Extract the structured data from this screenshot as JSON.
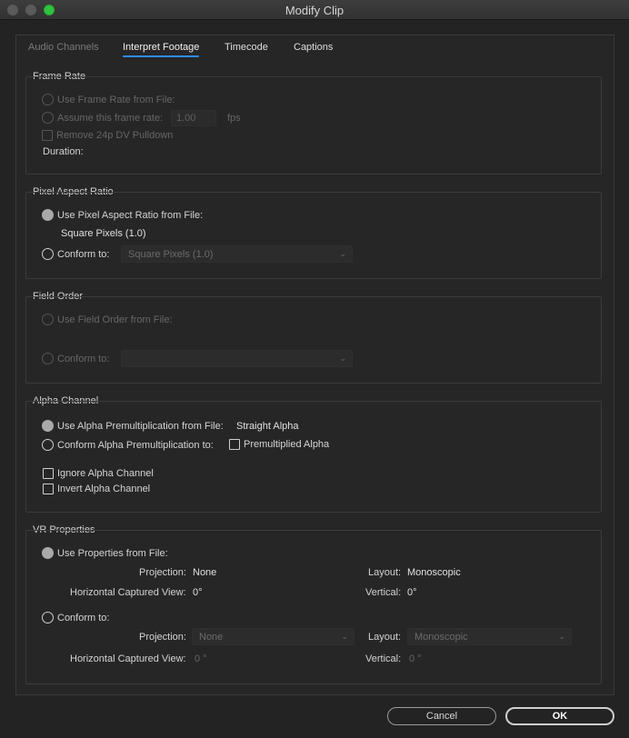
{
  "window": {
    "title": "Modify Clip"
  },
  "tabs": [
    {
      "label": "Audio Channels"
    },
    {
      "label": "Interpret Footage"
    },
    {
      "label": "Timecode"
    },
    {
      "label": "Captions"
    }
  ],
  "frame_rate": {
    "title": "Frame Rate",
    "use_from_file": "Use Frame Rate from File:",
    "assume": "Assume this frame rate:",
    "rate_value": "1.00",
    "unit": "fps",
    "remove_pulldown": "Remove 24p DV Pulldown",
    "duration": "Duration:"
  },
  "pixel_aspect": {
    "title": "Pixel Aspect Ratio",
    "use_from_file": "Use Pixel Aspect Ratio from File:",
    "file_value": "Square Pixels (1.0)",
    "conform": "Conform to:",
    "conform_value": "Square Pixels (1.0)"
  },
  "field_order": {
    "title": "Field Order",
    "use_from_file": "Use Field Order from File:",
    "conform": "Conform to:",
    "conform_value": ""
  },
  "alpha": {
    "title": "Alpha Channel",
    "use_from_file": "Use Alpha Premultiplication from File:",
    "file_value": "Straight Alpha",
    "conform": "Conform Alpha Premultiplication to:",
    "premultiplied": "Premultiplied Alpha",
    "ignore": "Ignore Alpha Channel",
    "invert": "Invert Alpha Channel"
  },
  "vr": {
    "title": "VR Properties",
    "use_from_file": "Use Properties from File:",
    "projection_label": "Projection:",
    "projection_value": "None",
    "layout_label": "Layout:",
    "layout_value": "Monoscopic",
    "hcv_label": "Horizontal Captured View:",
    "hcv_value": "0°",
    "vertical_label": "Vertical:",
    "vertical_value": "0°",
    "conform": "Conform to:",
    "conform_projection": "None",
    "conform_layout": "Monoscopic",
    "conform_hcv": "0 °",
    "conform_vertical": "0 °"
  },
  "buttons": {
    "cancel": "Cancel",
    "ok": "OK"
  }
}
